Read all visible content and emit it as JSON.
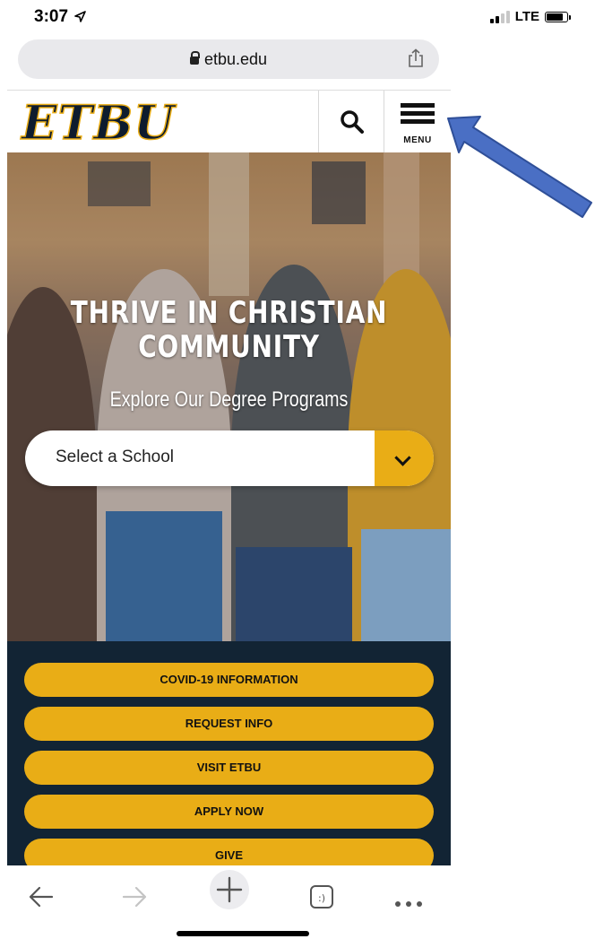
{
  "status_bar": {
    "time": "3:07",
    "network": "LTE"
  },
  "browser": {
    "url": "etbu.edu"
  },
  "header": {
    "logo_text": "ETBU",
    "menu_label": "MENU"
  },
  "hero": {
    "title_line1": "THRIVE IN CHRISTIAN",
    "title_line2": "COMMUNITY",
    "subtitle": "Explore Our Degree Programs",
    "select_placeholder": "Select a School"
  },
  "actions": [
    {
      "label": "COVID-19 INFORMATION"
    },
    {
      "label": "REQUEST INFO"
    },
    {
      "label": "VISIT ETBU"
    },
    {
      "label": "APPLY NOW"
    },
    {
      "label": "GIVE"
    }
  ],
  "colors": {
    "brand_gold": "#e9ad16",
    "brand_navy": "#122434",
    "arrow": "#4a6fc4"
  },
  "icons": [
    "location-arrow-icon",
    "signal-icon",
    "battery-icon",
    "lock-icon",
    "share-icon",
    "search-icon",
    "hamburger-menu-icon",
    "chevron-down-icon",
    "back-arrow-icon",
    "forward-arrow-icon",
    "plus-icon",
    "tabs-icon",
    "more-icon"
  ]
}
